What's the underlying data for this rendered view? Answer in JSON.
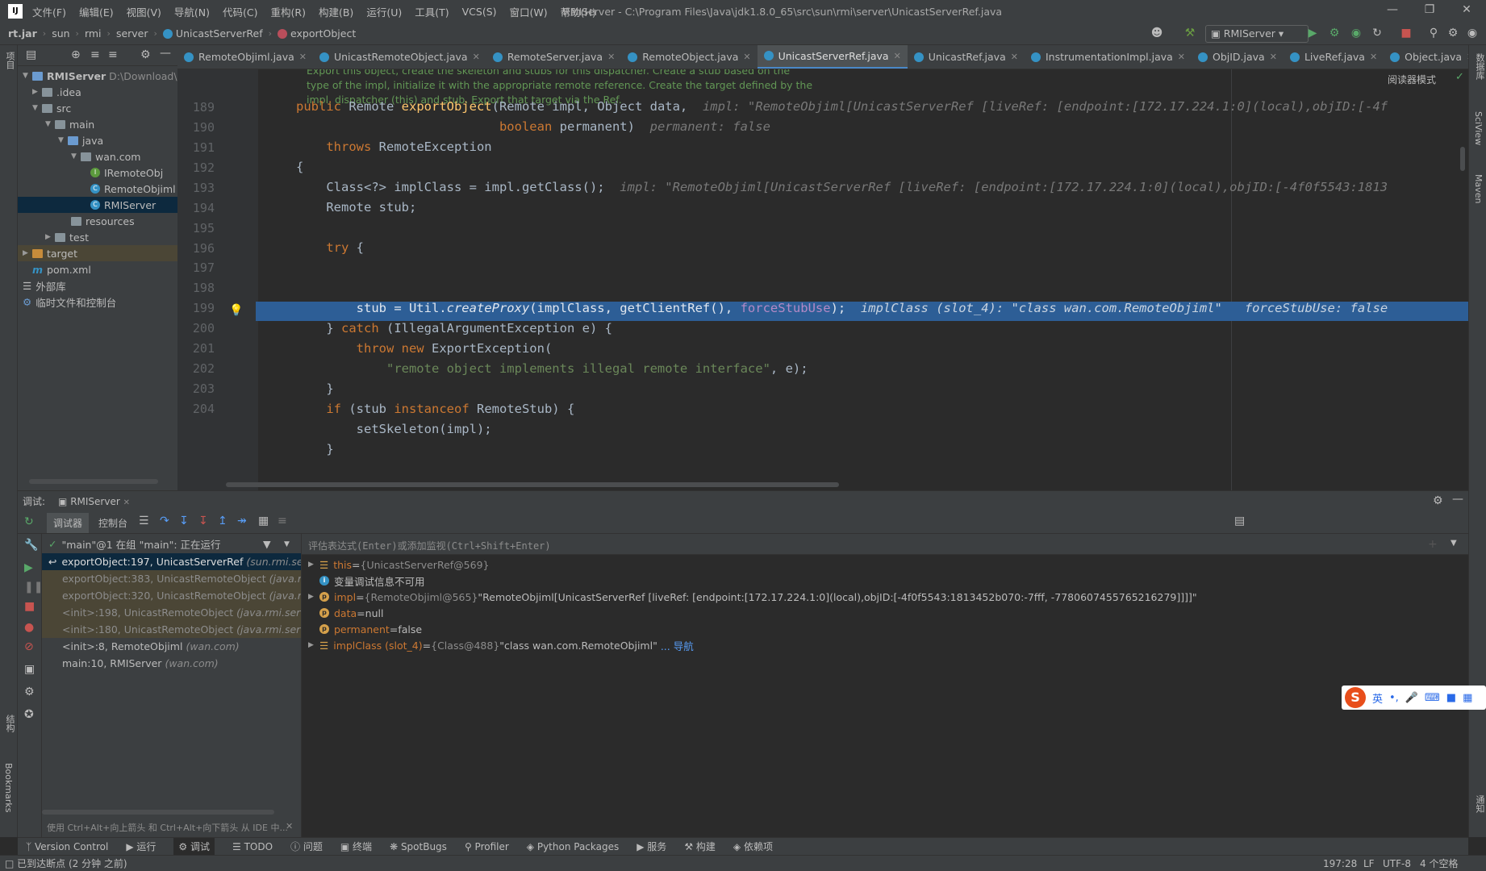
{
  "menu": {
    "items": [
      "文件(F)",
      "编辑(E)",
      "视图(V)",
      "导航(N)",
      "代码(C)",
      "重构(R)",
      "构建(B)",
      "运行(U)",
      "工具(T)",
      "VCS(S)",
      "窗口(W)",
      "帮助(H)"
    ],
    "title": "RMIServer - C:\\Program Files\\Java\\jdk1.8.0_65\\src\\sun\\rmi\\server\\UnicastServerRef.java"
  },
  "breadcrumb": {
    "items": [
      "rt.jar",
      "sun",
      "rmi",
      "server",
      "UnicastServerRef",
      "exportObject"
    ]
  },
  "toolbar": {
    "run_config": "RMIServer"
  },
  "left_strip": {
    "project": "项目"
  },
  "right_strip": {
    "database": "数据库",
    "sciview": "SciView",
    "maven": "Maven",
    "notifications": "通知"
  },
  "project_tree": {
    "root": "RMIServer",
    "root_path": "D:\\Download\\RMIS",
    "nodes": [
      ".idea",
      "src",
      "main",
      "java",
      "wan.com",
      "IRemoteObj",
      "RemoteObjiml",
      "RMIServer",
      "resources",
      "test",
      "target",
      "pom.xml",
      "外部库",
      "临时文件和控制台"
    ]
  },
  "tabs": [
    "RemoteObjiml.java",
    "UnicastRemoteObject.java",
    "RemoteServer.java",
    "RemoteObject.java",
    "UnicastServerRef.java",
    "UnicastRef.java",
    "InstrumentationImpl.java",
    "ObjID.java",
    "LiveRef.java",
    "Object.java"
  ],
  "active_tab": "UnicastServerRef.java",
  "editor": {
    "reader_mode": "阅读器模式",
    "doc_lines": [
      "Export this object, create the skeleton and stubs for this dispatcher. Create a stub based on the",
      "type of the impl, initialize it with the appropriate remote reference. Create the target defined by the",
      "impl, dispatcher (this) and stub. Export that target via the Ref."
    ],
    "line_numbers": [
      "189",
      "190",
      "191",
      "192",
      "193",
      "194",
      "195",
      "196",
      "197",
      "198",
      "199",
      "200",
      "201",
      "202",
      "203",
      "204"
    ],
    "hint_impl_189": "impl: \"RemoteObjiml[UnicastServerRef [liveRef: [endpoint:[172.17.224.1:0](local),objID:[-4f",
    "hint_permanent": "permanent: false",
    "hint_impl_193": "impl: \"RemoteObjiml[UnicastServerRef [liveRef: [endpoint:[172.17.224.1:0](local),objID:[-4f0f5543:1813",
    "hint_197a": "implClass (slot_4): \"class wan.com.RemoteObjiml\"",
    "hint_197b": "forceStubUse: false",
    "str_200": "\"remote object implements illegal remote interface\""
  },
  "debug": {
    "label": "调试:",
    "session": "RMIServer",
    "tab_debugger": "调试器",
    "tab_console": "控制台",
    "thread": "\"main\"@1 在组 \"main\": 正在运行",
    "eval_placeholder": "评估表达式(Enter)或添加监视(Ctrl+Shift+Enter)",
    "frames": [
      {
        "m": "exportObject:197, UnicastServerRef",
        "p": "(sun.rmi.server."
      },
      {
        "m": "exportObject:383, UnicastRemoteObject",
        "p": "(java.rmi.se"
      },
      {
        "m": "exportObject:320, UnicastRemoteObject",
        "p": "(java.rmi.se"
      },
      {
        "m": "<init>:198, UnicastRemoteObject",
        "p": "(java.rmi.server)"
      },
      {
        "m": "<init>:180, UnicastRemoteObject",
        "p": "(java.rmi.server)"
      },
      {
        "m": "<init>:8, RemoteObjiml",
        "p": "(wan.com)"
      },
      {
        "m": "main:10, RMIServer",
        "p": "(wan.com)"
      }
    ],
    "hint_bottom": "使用 Ctrl+Alt+向上箭头 和 Ctrl+Alt+向下箭头 从 IDE 中...",
    "vars": [
      {
        "name": "this",
        "eq": " = ",
        "ref": "{UnicastServerRef@569}",
        "val": ""
      },
      {
        "name": "",
        "eq": "",
        "ref": "",
        "val": "变量调试信息不可用"
      },
      {
        "name": "impl",
        "eq": " = ",
        "ref": "{RemoteObjiml@565}",
        "val": " \"RemoteObjiml[UnicastServerRef [liveRef: [endpoint:[172.17.224.1:0](local),objID:[-4f0f5543:1813452b070:-7fff, -7780607455765216279]]]]\""
      },
      {
        "name": "data",
        "eq": " = ",
        "ref": "",
        "val": "null"
      },
      {
        "name": "permanent",
        "eq": " = ",
        "ref": "",
        "val": "false"
      },
      {
        "name": "implClass (slot_4)",
        "eq": " = ",
        "ref": "{Class@488}",
        "val": " \"class wan.com.RemoteObjiml\"",
        "link": "... 导航"
      }
    ]
  },
  "bottom_tabs": [
    "Version Control",
    "运行",
    "调试",
    "TODO",
    "问题",
    "终端",
    "SpotBugs",
    "Profiler",
    "Python Packages",
    "服务",
    "构建",
    "依赖项"
  ],
  "status": {
    "left": "已到达断点 (2 分钟 之前)",
    "pos": "197:28",
    "le": "LF",
    "enc": "UTF-8",
    "indent": "4 个空格"
  },
  "ime": {
    "items": [
      "英",
      "•,"
    ]
  }
}
